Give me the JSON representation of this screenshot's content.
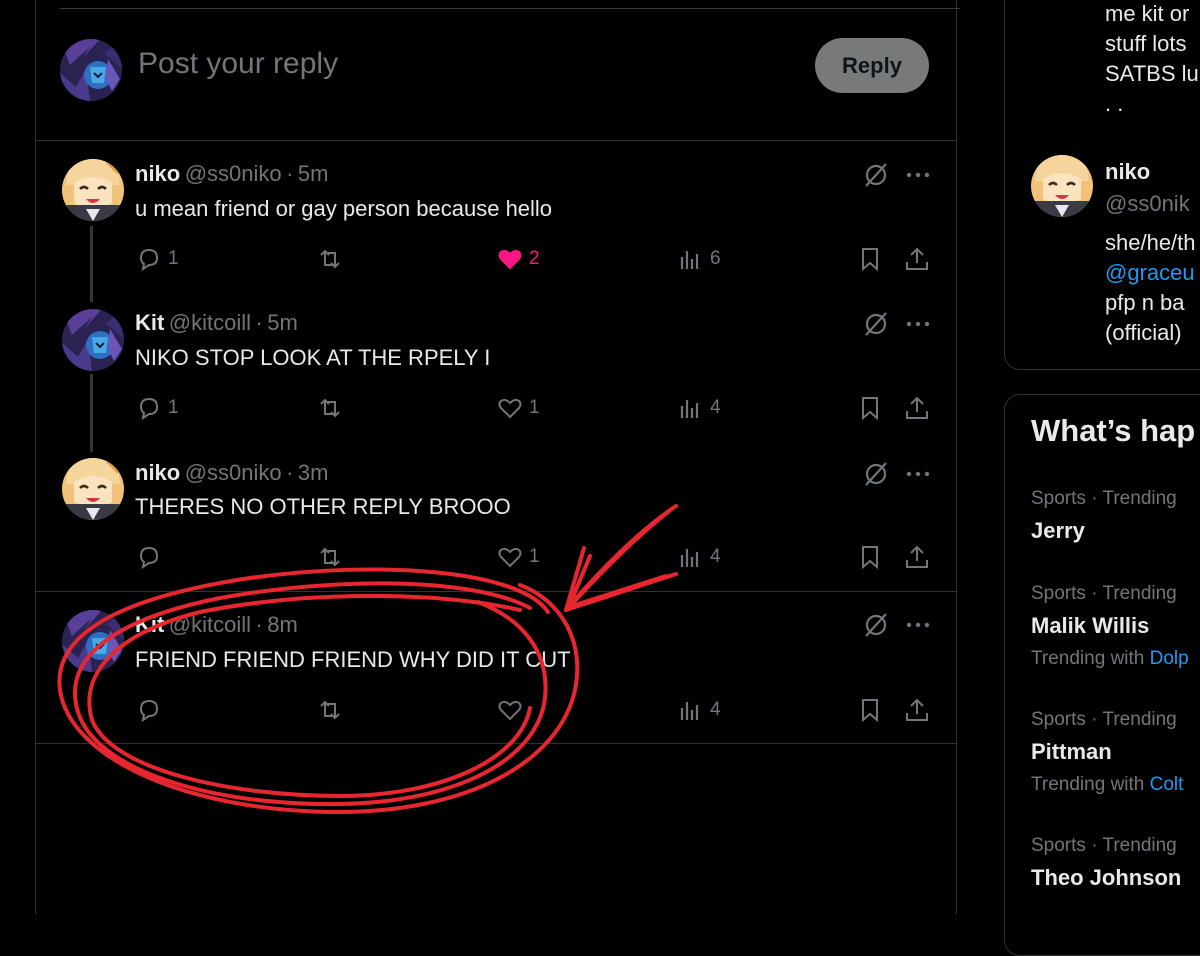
{
  "composer": {
    "placeholder": "Post your reply",
    "reply_label": "Reply"
  },
  "posts": [
    {
      "name": "niko",
      "handle": "@ss0niko",
      "sep": "·",
      "time": "5m",
      "text": "u mean friend or gay person because hello",
      "replies": "1",
      "reposts": "",
      "likes": "2",
      "liked": true,
      "views": "6",
      "avatar": "niko-avatar"
    },
    {
      "name": "Kit",
      "handle": "@kitcoill",
      "sep": "·",
      "time": "5m",
      "text": "NIKO STOP LOOK AT THE RPELY I",
      "replies": "1",
      "reposts": "",
      "likes": "1",
      "liked": false,
      "views": "4",
      "avatar": "kit-avatar"
    },
    {
      "name": "niko",
      "handle": "@ss0niko",
      "sep": "·",
      "time": "3m",
      "text": "THERES NO OTHER REPLY BROOO",
      "replies": "",
      "reposts": "",
      "likes": "1",
      "liked": false,
      "views": "4",
      "avatar": "niko-avatar"
    },
    {
      "name": "Kit",
      "handle": "@kitcoill",
      "sep": "·",
      "time": "8m",
      "text": "FRIEND FRIEND FRIEND WHY DID IT CUT",
      "replies": "",
      "reposts": "",
      "likes": "",
      "liked": false,
      "views": "4",
      "avatar": "kit-avatar"
    }
  ],
  "right_profile": {
    "bio_top": [
      "me kit or",
      "stuff lots",
      "SATBS lu",
      ". ."
    ],
    "name": "niko",
    "handle": "@ss0nik",
    "bio_lines": [
      "she/he/th",
      "@graceu",
      "pfp n ba",
      "(official)"
    ]
  },
  "trends": {
    "heading": "What’s hap",
    "items": [
      {
        "category": "Sports · Trending",
        "name": "Jerry",
        "with_label": "",
        "with_link": ""
      },
      {
        "category": "Sports · Trending",
        "name": "Malik Willis",
        "with_label": "Trending with ",
        "with_link": "Dolp"
      },
      {
        "category": "Sports · Trending",
        "name": "Pittman",
        "with_label": "Trending with ",
        "with_link": "Colt"
      },
      {
        "category": "Sports · Trending",
        "name": "Theo Johnson",
        "with_label": "",
        "with_link": ""
      }
    ]
  },
  "annotation": {
    "color": "#e8262f",
    "type": "hand-drawn circle and arrow"
  },
  "colors": {
    "background": "#000000",
    "text": "#e7e9ea",
    "muted": "#71767b",
    "like": "#f91880",
    "link": "#1d9bf0",
    "divider": "#2f3336"
  }
}
